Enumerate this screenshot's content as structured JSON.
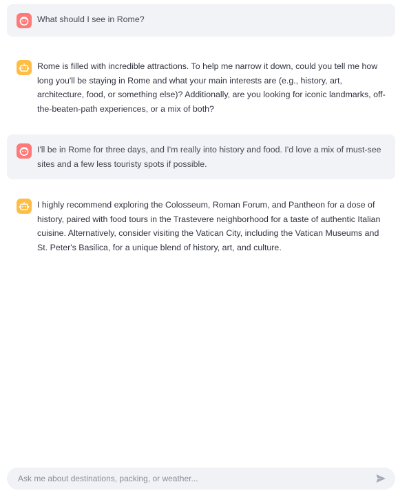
{
  "messages": [
    {
      "role": "user",
      "avatar_icon": "user-face-icon",
      "text": "What should I see in Rome?"
    },
    {
      "role": "assistant",
      "avatar_icon": "robot-icon",
      "text": "Rome is filled with incredible attractions. To help me narrow it down, could you tell me how long you'll be staying in Rome and what your main interests are (e.g., history, art, architecture, food, or something else)? Additionally, are you looking for iconic landmarks, off-the-beaten-path experiences, or a mix of both?"
    },
    {
      "role": "user",
      "avatar_icon": "user-face-icon",
      "text": "I'll be in Rome for three days, and I'm really into history and food. I'd love a mix of must-see sites and a few less touristy spots if possible."
    },
    {
      "role": "assistant",
      "avatar_icon": "robot-icon",
      "text": "I highly recommend exploring the Colosseum, Roman Forum, and Pantheon for a dose of history, paired with food tours in the Trastevere neighborhood for a taste of authentic Italian cuisine. Alternatively, consider visiting the Vatican City, including the Vatican Museums and St. Peter's Basilica, for a unique blend of history, art, and culture."
    }
  ],
  "chat_input": {
    "placeholder": "Ask me about destinations, packing, or weather...",
    "value": "",
    "send_icon": "send-icon"
  },
  "colors": {
    "user_avatar_bg": "#ff6b6b",
    "assistant_avatar_bg": "#ffbd45",
    "user_bubble_bg": "#f0f2f6",
    "text": "#31333f"
  }
}
